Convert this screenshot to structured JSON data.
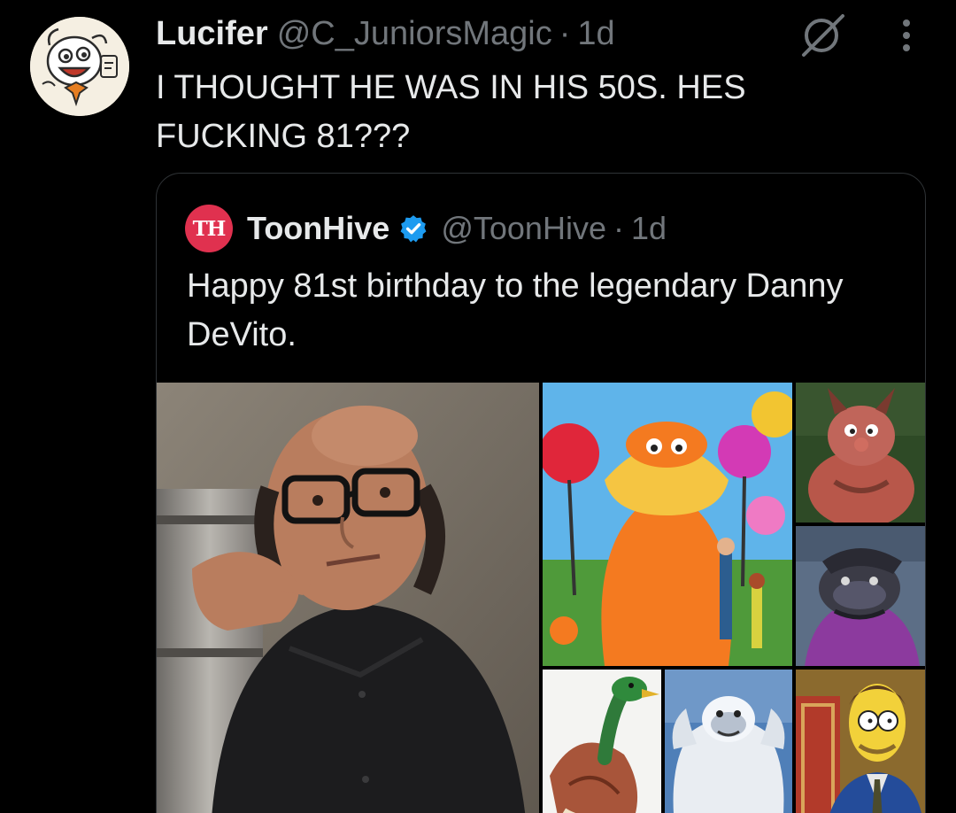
{
  "tweet": {
    "display_name": "Lucifer",
    "handle": "@C_JuniorsMagic",
    "separator": "·",
    "time": "1d",
    "text": "I THOUGHT HE WAS IN HIS 50S. HES FUCKING 81???",
    "avatar_icon": "cartoon-character-avatar",
    "grok_icon": "grok-icon",
    "more_icon": "more-horizontal-icon"
  },
  "quote": {
    "avatar_text": "TH",
    "avatar_color": "#e0314f",
    "display_name": "ToonHive",
    "verified_icon": "verified-badge-icon",
    "verified_color": "#1d9bf0",
    "handle": "@ToonHive",
    "separator": "·",
    "time": "1d",
    "text": "Happy 81st birthday to the legendary Danny DeVito."
  },
  "media": {
    "images": [
      "photo-of-danny-devito",
      "lorax-still",
      "phil-hercules-still",
      "hoggish-greedly-still",
      "duck-character-still",
      "yeti-character-still",
      "herb-powell-simpsons-still"
    ]
  },
  "colors": {
    "background": "#000000",
    "text_primary": "#e7e9ea",
    "text_secondary": "#71767b",
    "border": "#2f3336"
  }
}
